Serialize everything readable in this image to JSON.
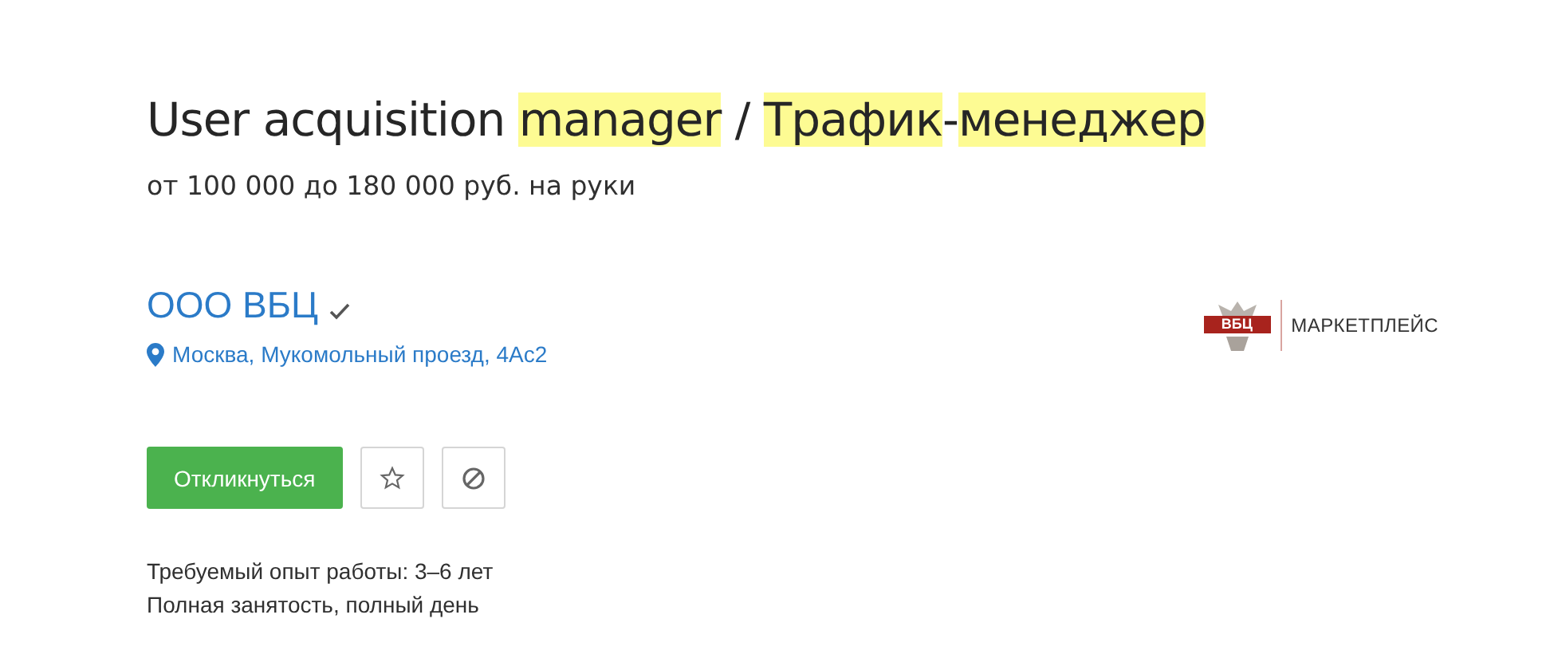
{
  "vacancy": {
    "title": [
      {
        "text": "User acquisition ",
        "highlighted": false
      },
      {
        "text": "manager",
        "highlighted": true
      },
      {
        "text": " / ",
        "highlighted": false
      },
      {
        "text": "Трафик",
        "highlighted": true
      },
      {
        "text": "-",
        "highlighted": false
      },
      {
        "text": "менеджер",
        "highlighted": true
      }
    ],
    "salary": "от 100 000 до 180 000 руб. на руки"
  },
  "company": {
    "name": "ООО ВБЦ",
    "verified": true,
    "address": "Москва, Мукомольный проезд, 4Ас2",
    "logo": {
      "emblem_text": "ВБЦ",
      "wordmark": "МАРКЕТПЛЕЙС"
    }
  },
  "actions": {
    "respond": "Откликнуться",
    "buttons": [
      {
        "kind": "favorite"
      },
      {
        "kind": "hide"
      }
    ]
  },
  "details": [
    "Требуемый опыт работы: 3–6 лет",
    "Полная занятость, полный день"
  ]
}
